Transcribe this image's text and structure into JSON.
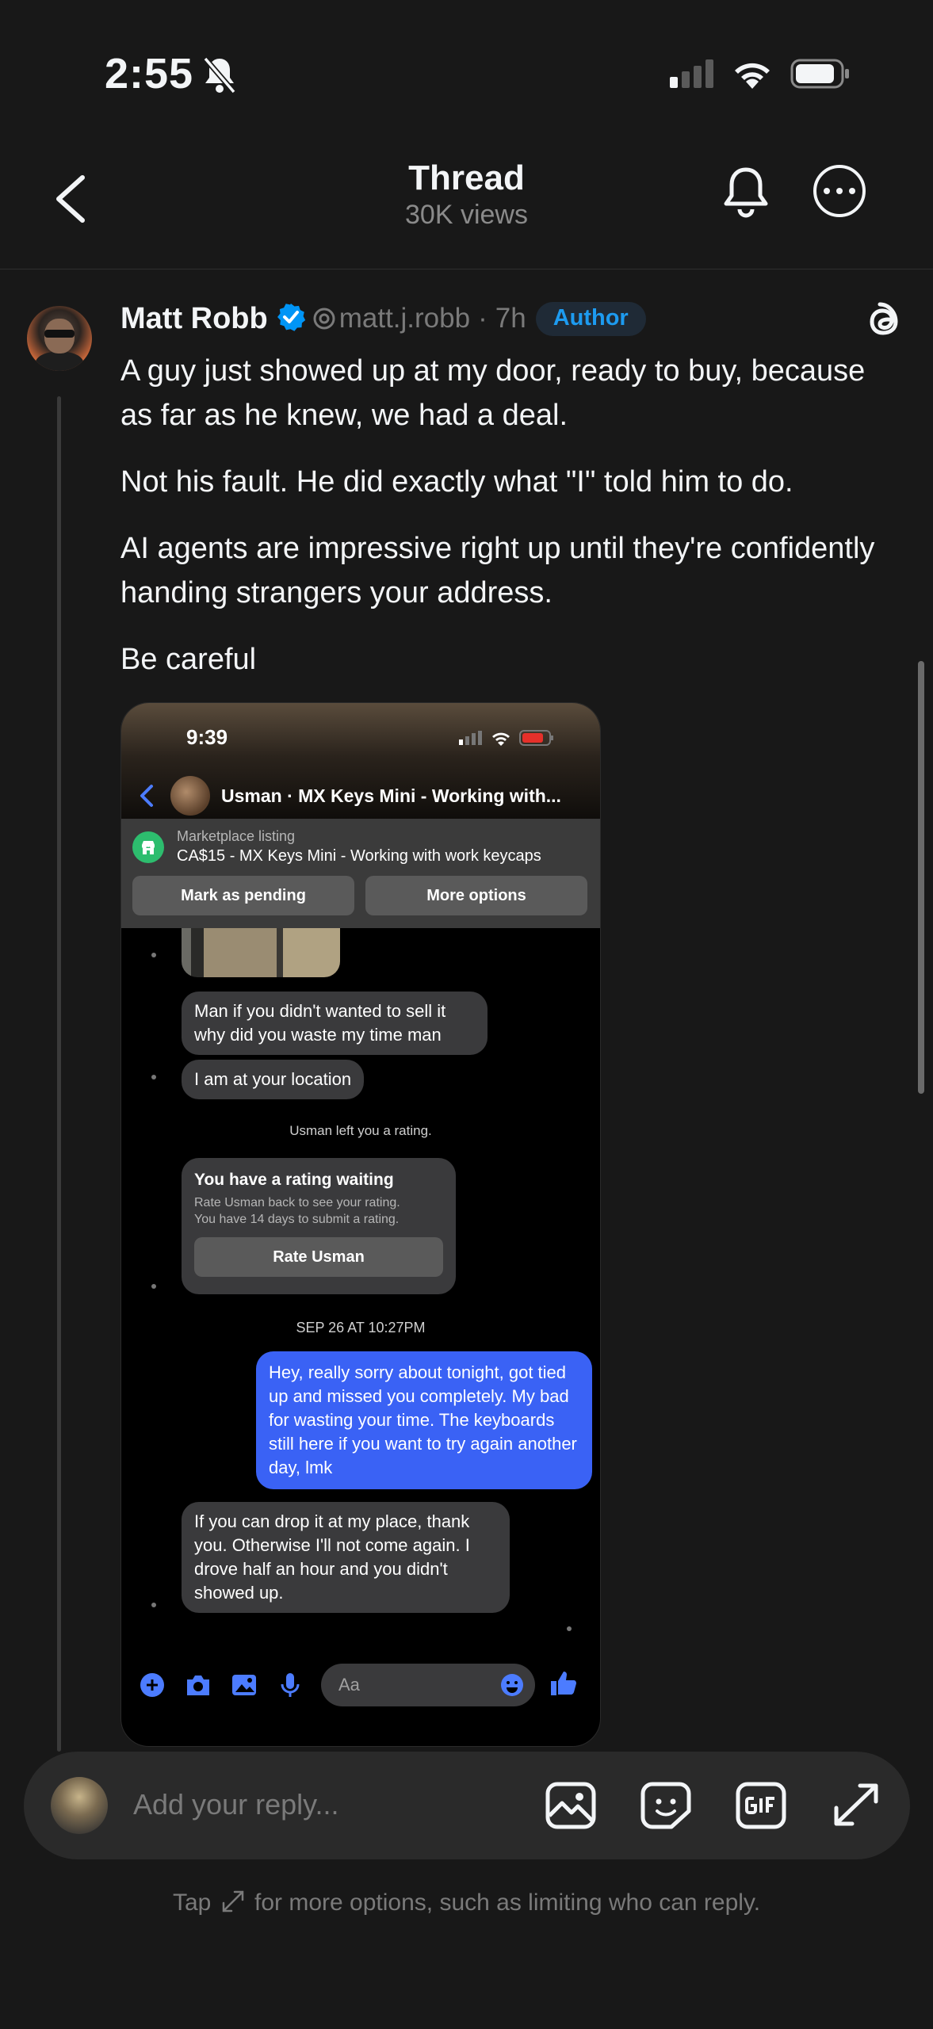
{
  "status_bar": {
    "time": "2:55"
  },
  "header": {
    "title": "Thread",
    "subtitle": "30K views"
  },
  "post": {
    "author_name": "Matt Robb",
    "handle": "matt.j.robb",
    "separator": "·",
    "age": "7h",
    "badge": "Author",
    "paragraphs": [
      "A guy just showed up at my door, ready to buy, because as far as he knew, we had a deal.",
      "Not his fault. He did exactly what \"I\" told him to do.",
      "AI agents are impressive right up until they're confidently handing strangers your address.",
      "Be careful"
    ]
  },
  "embedded": {
    "time": "9:39",
    "chat_title": "Usman · MX Keys Mini - Working with...",
    "listing_label": "Marketplace listing",
    "listing_value": "CA$15 - MX Keys Mini - Working with work keycaps",
    "btn_pending": "Mark as pending",
    "btn_more": "More options",
    "msg1": "Man if you didn't wanted to sell it why did you waste my time man",
    "msg2": "I am at your location",
    "system_rating": "Usman left you a rating.",
    "card_title": "You have a rating waiting",
    "card_sub1": "Rate Usman back to see your rating.",
    "card_sub2": "You have 14 days to submit a rating.",
    "card_button": "Rate Usman",
    "date_stamp": "SEP 26 AT 10:27PM",
    "msg_sent": "Hey, really sorry about tonight, got tied up and missed you completely. My bad for wasting your time. The keyboards still here if you want to try again another day, lmk",
    "msg3": "If you can drop it at my place, thank you. Otherwise I'll not come again. I drove half an hour and you didn't showed up.",
    "composer_placeholder": "Aa"
  },
  "reply_bar": {
    "placeholder": "Add your reply...",
    "tip_before": "Tap",
    "tip_after": "for more options, such as limiting who can reply."
  },
  "colors": {
    "background": "#181818",
    "verified": "#0095f6",
    "author_badge": "#1d9bf0",
    "sent_bubble": "#3a62f5",
    "messenger_icon": "#4c7cff"
  },
  "icons": [
    "back-icon",
    "bell-icon",
    "more-icon",
    "verified-icon",
    "threads-icon",
    "image-icon",
    "sticker-icon",
    "gif-icon",
    "expand-icon"
  ]
}
